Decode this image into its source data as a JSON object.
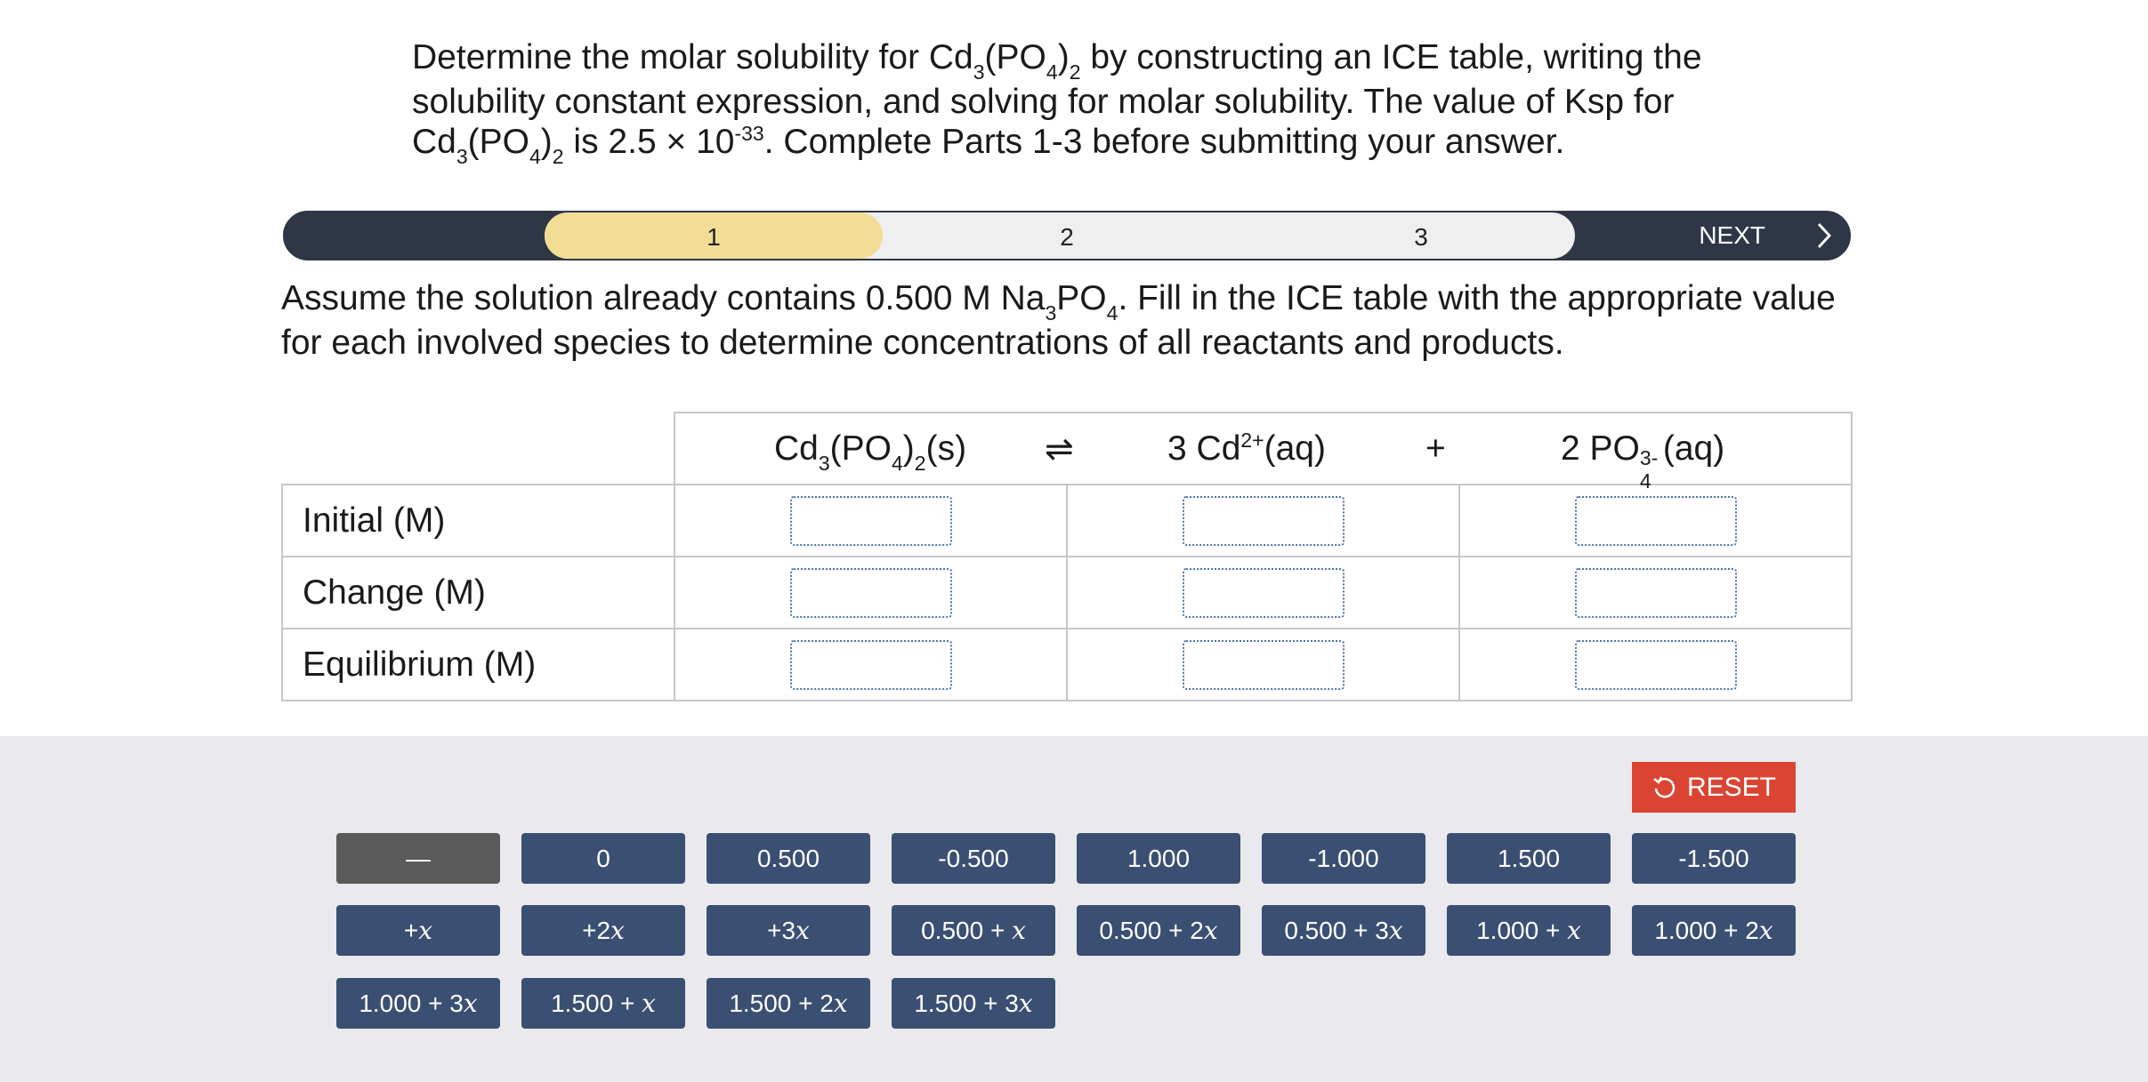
{
  "problem": {
    "t1": "Determine the molar solubility for Cd",
    "sub3": "3",
    "t2": "(PO",
    "sub4": "4",
    "t3": ")",
    "sub2": "2",
    "t4": " by constructing an ICE table, writing the solubility constant expression, and solving for molar solubility. The value of Ksp for Cd",
    "t5": " is 2.5 × 10",
    "sup_exp": "-33",
    "t6": ". Complete Parts 1-3 before submitting your answer."
  },
  "stepper": {
    "steps": [
      "1",
      "2",
      "3"
    ],
    "active_step": "1",
    "next_label": "NEXT",
    "active_color": "#f2dd95",
    "bar_color": "#2f3747"
  },
  "instruction": {
    "t1": "Assume the solution already contains 0.500 M Na",
    "sub3": "3",
    "t2": "PO",
    "sub4": "4",
    "t3": ". Fill in the ICE table with the appropriate value for each involved species to determine concentrations of all reactants and products."
  },
  "equation": {
    "reactant": {
      "a": "Cd",
      "s1": "3",
      "b": "(PO",
      "s2": "4",
      "c": ")",
      "s3": "2",
      "d": "(s)"
    },
    "arrow": "⇌",
    "product1": {
      "a": "3 Cd",
      "sup": "2+",
      "b": "(aq)"
    },
    "plus": "+",
    "product2": {
      "a": "2 PO",
      "sub": "4",
      "sup": "3-",
      "b": "(aq)"
    }
  },
  "ice_rows": [
    "Initial (M)",
    "Change (M)",
    "Equilibrium (M)"
  ],
  "reset_label": "RESET",
  "tiles": {
    "r1": [
      "—",
      "0",
      "0.500",
      "-0.500",
      "1.000",
      "-1.000",
      "1.500",
      "-1.500"
    ],
    "r2": [
      {
        "pre": "+",
        "x": "x",
        "post": ""
      },
      {
        "pre": "+2",
        "x": "x",
        "post": ""
      },
      {
        "pre": "+3",
        "x": "x",
        "post": ""
      },
      {
        "pre": "0.500 + ",
        "x": "x",
        "post": ""
      },
      {
        "pre": "0.500 + 2",
        "x": "x",
        "post": ""
      },
      {
        "pre": "0.500 + 3",
        "x": "x",
        "post": ""
      },
      {
        "pre": "1.000 + ",
        "x": "x",
        "post": ""
      },
      {
        "pre": "1.000 + 2",
        "x": "x",
        "post": ""
      }
    ],
    "r3": [
      {
        "pre": "1.000 + 3",
        "x": "x",
        "post": ""
      },
      {
        "pre": "1.500 + ",
        "x": "x",
        "post": ""
      },
      {
        "pre": "1.500 + 2",
        "x": "x",
        "post": ""
      },
      {
        "pre": "1.500 + 3",
        "x": "x",
        "post": ""
      }
    ],
    "tile_color": "#3a4f72",
    "reset_color": "#d94532"
  }
}
